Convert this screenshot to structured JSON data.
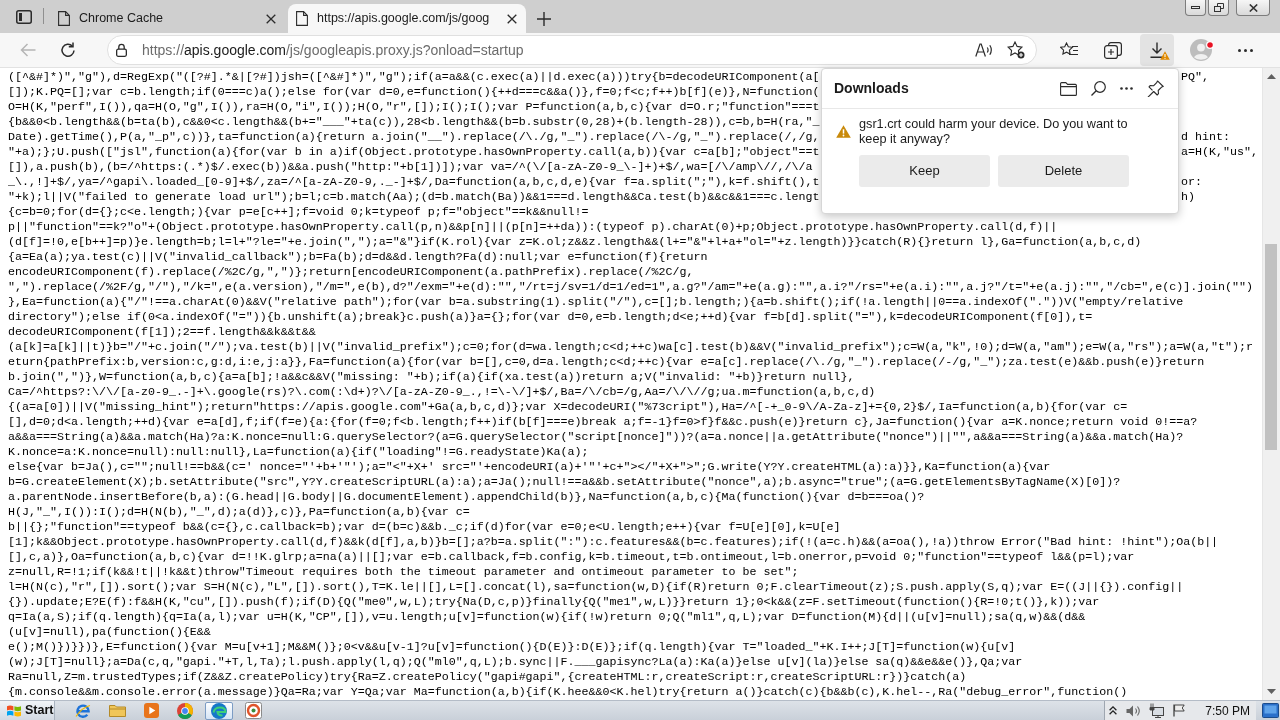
{
  "browser": {
    "tabs": [
      {
        "title": "Chrome Cache",
        "selected": false
      },
      {
        "title": "https://apis.google.com/js/goog",
        "selected": true
      }
    ],
    "back": {
      "disabled": true
    },
    "address_bar": {
      "scheme": "https://",
      "host": "apis.google.com",
      "path": "/js/googleapis.proxy.js?onload=startup"
    },
    "downloads_button": {
      "selected": true,
      "warning": true
    }
  },
  "source": {
    "lines": [
      {
        "text": "([^&#]*)\",\"g\"),d=RegExp(\"([?#].*&|[?#])jsh=([^&#]*)\",\"g\");if(a=a&&(c.exec(a)||d.exec(a)))try{b=decodeURIComponent(a[",
        "right_of_popup": "PQ\","
      },
      {
        "text": "[]);K.PQ=[];var c=b.length;if(0===c)a();else for(var d=0,e=function(){++d===c&&a()},f=0;f<c;f++)b[f](e)},N=function("
      },
      {
        "text": "O=H(K,\"perf\",I()),qa=H(O,\"g\",I()),ra=H(O,\"i\",I());H(O,\"r\",[]);I();I();var P=function(a,b,c){var d=O.r;\"function\"===t"
      },
      {
        "text": "{b&&0<b.length&&(b=ta(b),c&&0<c.length&&(b+=\"___\"+ta(c)),28<b.length&&(b=b.substr(0,28)+(b.length-28)),c=b,b=H(ra,\"_"
      },
      {
        "text": "Date).getTime(),P(a,\"_p\",c))},ta=function(a){return a.join(\"__\").replace(/\\./g,\"_\").replace(/\\-/g,\"_\").replace(/,/g,",
        "right_of_popup": "d hint:"
      },
      {
        "text": "\"+a);};U.push([\"jsl\",function(a){for(var b in a)if(Object.prototype.hasOwnProperty.call(a,b)){var c=a[b];\"object\"==t",
        "right_of_popup": "a=H(K,\"us\","
      },
      {
        "text": "[]),a.push(b),(b=/^https:(.*)$/.exec(b))&&a.push(\"http:\"+b[1])]);var va=/^(\\/[a-zA-Z0-9_\\-]+)+$/,wa=[/\\/amp\\//,/\\/a"
      },
      {
        "text": "_\\.,!]+$/,ya=/^gapi\\.loaded_[0-9]+$/,za=/^[a-zA-Z0-9,._-]+$/,Da=function(a,b,c,d,e){var f=a.split(\";\"),k=f.shift(),t",
        "right_of_popup": "or:"
      },
      {
        "text": "\"+k);l||V(\"failed to generate load url\");b=l;c=b.match(Aa);(d=b.match(Ba))&&1===d.length&&Ca.test(b)&&c&&1===c.lengt",
        "right_of_popup": "h)"
      },
      {
        "text": "{c=b=0;for(d={};c<e.length;){var p=e[c++];f=void 0;k=typeof p;f=\"object\"==k&&null!="
      },
      {
        "text": "p||\"function\"==k?\"o\"+(Object.prototype.hasOwnProperty.call(p,n)&&p[n]||(p[n]=++da)):(typeof p).charAt(0)+p;Object.prototype.hasOwnProperty.call(d,f)||"
      },
      {
        "text": "(d[f]=!0,e[b++]=p)}e.length=b;l=l+\"?le=\"+e.join(\",\");a=\"&\"}if(K.rol){var z=K.ol;z&&z.length&&(l+=\"&\"+l+a+\"ol=\"+z.length)}}catch(R){}return l},Ga=function(a,b,c,d)"
      },
      {
        "text": "{a=Ea(a);ya.test(c)||V(\"invalid_callback\");b=Fa(b);d=d&&d.length?Fa(d):null;var e=function(f){return"
      },
      {
        "text": "encodeURIComponent(f).replace(/%2C/g,\",\")};return[encodeURIComponent(a.pathPrefix).replace(/%2C/g,"
      },
      {
        "text": "\",\").replace(/%2F/g,\"/\"),\"/k=\",e(a.version),\"/m=\",e(b),d?\"/exm=\"+e(d):\"\",\"/rt=j/sv=1/d=1/ed=1\",a.g?\"/am=\"+e(a.g):\"\",a.i?\"/rs=\"+e(a.i):\"\",a.j?\"/t=\"+e(a.j):\"\",\"/cb=\",e(c)].join(\"\")"
      },
      {
        "text": "},Ea=function(a){\"/\"!==a.charAt(0)&&V(\"relative path\");for(var b=a.substring(1).split(\"/\"),c=[];b.length;){a=b.shift();if(!a.length||0==a.indexOf(\".\"))V(\"empty/relative"
      },
      {
        "text": "directory\");else if(0<a.indexOf(\"=\")){b.unshift(a);break}c.push(a)}a={};for(var d=0,e=b.length;d<e;++d){var f=b[d].split(\"=\"),k=decodeURIComponent(f[0]),t="
      },
      {
        "text": "decodeURIComponent(f[1]);2==f.length&&k&&t&&"
      },
      {
        "text": "(a[k]=a[k]||t)}b=\"/\"+c.join(\"/\");va.test(b)||V(\"invalid_prefix\");c=0;for(d=wa.length;c<d;++c)wa[c].test(b)&&V(\"invalid_prefix\");c=W(a,\"k\",!0);d=W(a,\"am\");e=W(a,\"rs\");a=W(a,\"t\");r"
      },
      {
        "text": "eturn{pathPrefix:b,version:c,g:d,i:e,j:a}},Fa=function(a){for(var b=[],c=0,d=a.length;c<d;++c){var e=a[c].replace(/\\./g,\"_\").replace(/-/g,\"_\");za.test(e)&&b.push(e)}return"
      },
      {
        "text": "b.join(\",\")},W=function(a,b,c){a=a[b];!a&&c&&V(\"missing: \"+b);if(a){if(xa.test(a))return a;V(\"invalid: \"+b)}return null},"
      },
      {
        "text": "Ca=/^https?:\\/\\/[a-z0-9_.-]+\\.google(rs)?\\.com(:\\d+)?\\/[a-zA-Z0-9_.,!=\\-\\/]+$/,Ba=/\\/cb=/g,Aa=/\\/\\//g;ua.m=function(a,b,c,d)"
      },
      {
        "text": "{(a=a[0])||V(\"missing_hint\");return\"https://apis.google.com\"+Ga(a,b,c,d)};var X=decodeURI(\"%73cript\"),Ha=/^[-+_0-9\\/A-Za-z]+={0,2}$/,Ia=function(a,b){for(var c="
      },
      {
        "text": "[],d=0;d<a.length;++d){var e=a[d],f;if(f=e){a:{for(f=0;f<b.length;f++)if(b[f]===e)break a;f=-1}f=0>f}f&&c.push(e)}return c},Ja=function(){var a=K.nonce;return void 0!==a?"
      },
      {
        "text": "a&&a===String(a)&&a.match(Ha)?a:K.nonce=null:G.querySelector?(a=G.querySelector(\"script[nonce]\"))?(a=a.nonce||a.getAttribute(\"nonce\")||\"\",a&&a===String(a)&&a.match(Ha)?"
      },
      {
        "text": "K.nonce=a:K.nonce=null):null:null},La=function(a){if(\"loading\"!=G.readyState)Ka(a);"
      },
      {
        "text": "else{var b=Ja(),c=\"\";null!==b&&(c=' nonce=\"'+b+'\"');a=\"<\"+X+' src=\"'+encodeURI(a)+'\"'+c+\"></\"+X+\">\";G.write(Y?Y.createHTML(a):a)}},Ka=function(a){var"
      },
      {
        "text": "b=G.createElement(X);b.setAttribute(\"src\",Y?Y.createScriptURL(a):a);a=Ja();null!==a&&b.setAttribute(\"nonce\",a);b.async=\"true\";(a=G.getElementsByTagName(X)[0])?"
      },
      {
        "text": "a.parentNode.insertBefore(b,a):(G.head||G.body||G.documentElement).appendChild(b)},Na=function(a,b,c){Ma(function(){var d=b===oa()?"
      },
      {
        "text": "H(J,\"_\",I()):I();d=H(N(b),\"_\",d);a(d)},c)},Pa=function(a,b){var c="
      },
      {
        "text": "b||{};\"function\"==typeof b&&(c={},c.callback=b);var d=(b=c)&&b._c;if(d)for(var e=0;e<U.length;e++){var f=U[e][0],k=U[e]"
      },
      {
        "text": "[1];k&&Object.prototype.hasOwnProperty.call(d,f)&&k(d[f],a,b)}b=[];a?b=a.split(\":\"):c.features&&(b=c.features);if(!(a=c.h)&&(a=oa(),!a))throw Error(\"Bad hint: !hint\");Oa(b||"
      },
      {
        "text": "[],c,a)},Oa=function(a,b,c){var d=!!K.glrp;a=na(a)||[];var e=b.callback,f=b.config,k=b.timeout,t=b.ontimeout,l=b.onerror,p=void 0;\"function\"==typeof l&&(p=l);var"
      },
      {
        "text": "z=null,R=!1;if(k&&!t||!k&&t)throw\"Timeout requires both the timeout parameter and ontimeout parameter to be set\";"
      },
      {
        "text": "l=H(N(c),\"r\",[]).sort();var S=H(N(c),\"L\",[]).sort(),T=K.le||[],L=[].concat(l),sa=function(w,D){if(R)return 0;F.clearTimeout(z);S.push.apply(S,q);var E=((J||{}).config||"
      },
      {
        "text": "{}).update;E?E(f):f&&H(K,\"cu\",[]).push(f);if(D){Q(\"me0\",w,L);try{Na(D,c,p)}finally{Q(\"me1\",w,L)}}return 1};0<k&&(z=F.setTimeout(function(){R=!0;t()},k));var"
      },
      {
        "text": "q=Ia(a,S);if(q.length){q=Ia(a,l);var u=H(K,\"CP\",[]),v=u.length;u[v]=function(w){if(!w)return 0;Q(\"ml1\",q,L);var D=function(M){d||(u[v]=null);sa(q,w)&&(d&&"
      },
      {
        "text": "(u[v]=null),pa(function(){E&&"
      },
      {
        "text": "e();M()})}})},E=function(){var M=u[v+1];M&&M()};0<v&&u[v-1]?u[v]=function(){D(E)}:D(E)};if(q.length){var T=\"loaded_\"+K.I++;J[T]=function(w){u[v]"
      },
      {
        "text": "(w);J[T]=null};a=Da(c,q,\"gapi.\"+T,l,Ta);l.push.apply(l,q);Q(\"ml0\",q,L);b.sync||F.___gapisync?La(a):Ka(a)}else u[v](la)}else sa(q)&&e&&e()},Qa;var"
      },
      {
        "text": "Ra=null,Z=m.trustedTypes;if(Z&&Z.createPolicy)try{Ra=Z.createPolicy(\"gapi#gapi\",{createHTML:r,createScript:r,createScriptURL:r})}catch(a)"
      },
      {
        "text": "{m.console&&m.console.error(a.message)}Qa=Ra;var Y=Qa;var Ma=function(a,b){if(K.hee&&0<K.hel)try{return a()}catch(c){b&&b(c),K.hel--,Ra(\"debug_error\",function()"
      }
    ]
  },
  "downloads_panel": {
    "title": "Downloads",
    "warning": "gsr1.crt could harm your device. Do you want to keep it anyway?",
    "buttons": [
      "Keep",
      "Delete"
    ]
  },
  "taskbar": {
    "start": "Start",
    "pinned": [
      {
        "selected": false
      },
      {
        "selected": false
      },
      {
        "selected": false
      },
      {
        "selected": false
      },
      {
        "selected": true
      },
      {
        "selected": false
      }
    ],
    "clock": "7:50 PM"
  }
}
